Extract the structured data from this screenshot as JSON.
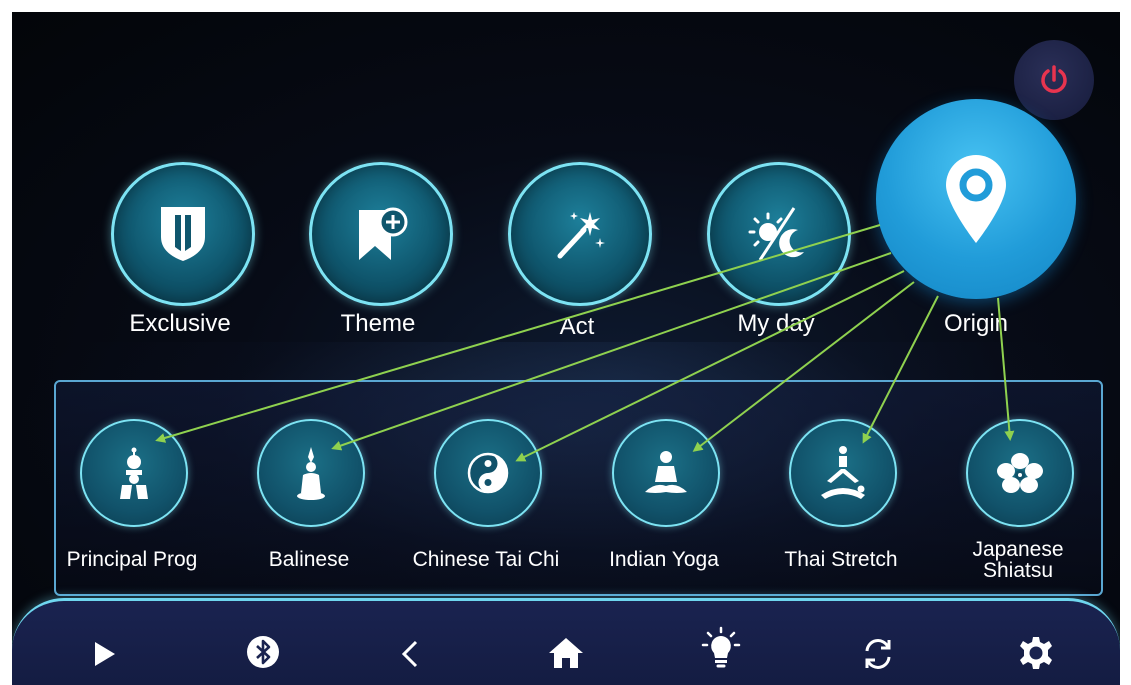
{
  "header": {
    "power_icon": "power-icon",
    "power_color": "#e8344f"
  },
  "modes": [
    {
      "id": "exclusive",
      "label": "Exclusive",
      "icon": "shield-icon"
    },
    {
      "id": "theme",
      "label": "Theme",
      "icon": "bookmark-plus-icon"
    },
    {
      "id": "act",
      "label": "Act",
      "icon": "magic-wand-icon"
    },
    {
      "id": "my-day",
      "label": "My day",
      "icon": "day-night-icon"
    },
    {
      "id": "origin",
      "label": "Origin",
      "icon": "location-pin-icon",
      "active": true
    }
  ],
  "sub_programs": [
    {
      "id": "principal-prog",
      "label": "Principal Prog",
      "icon": "monk-icon"
    },
    {
      "id": "balinese",
      "label": "Balinese",
      "icon": "praying-figure-icon"
    },
    {
      "id": "chinese-tai-chi",
      "label": "Chinese Tai Chi",
      "icon": "yin-yang-icon"
    },
    {
      "id": "indian-yoga",
      "label": "Indian Yoga",
      "icon": "meditation-icon"
    },
    {
      "id": "thai-stretch",
      "label": "Thai Stretch",
      "icon": "thai-stretch-icon"
    },
    {
      "id": "japanese-shiatsu",
      "label_line1": "Japanese",
      "label_line2": "Shiatsu",
      "icon": "flower-icon"
    }
  ],
  "bottom_bar": [
    {
      "id": "play",
      "icon": "play-icon"
    },
    {
      "id": "bluetooth",
      "icon": "bluetooth-icon"
    },
    {
      "id": "back",
      "icon": "chevron-left-icon"
    },
    {
      "id": "home",
      "icon": "home-icon"
    },
    {
      "id": "light",
      "icon": "light-bulb-icon"
    },
    {
      "id": "sync",
      "icon": "sync-icon"
    },
    {
      "id": "settings",
      "icon": "gear-icon"
    }
  ],
  "colors": {
    "accent_cyan": "#7de3f3",
    "origin_blue": "#219cd9",
    "arrow_green": "#8fd14f",
    "bar_bg": "#1a2350"
  }
}
